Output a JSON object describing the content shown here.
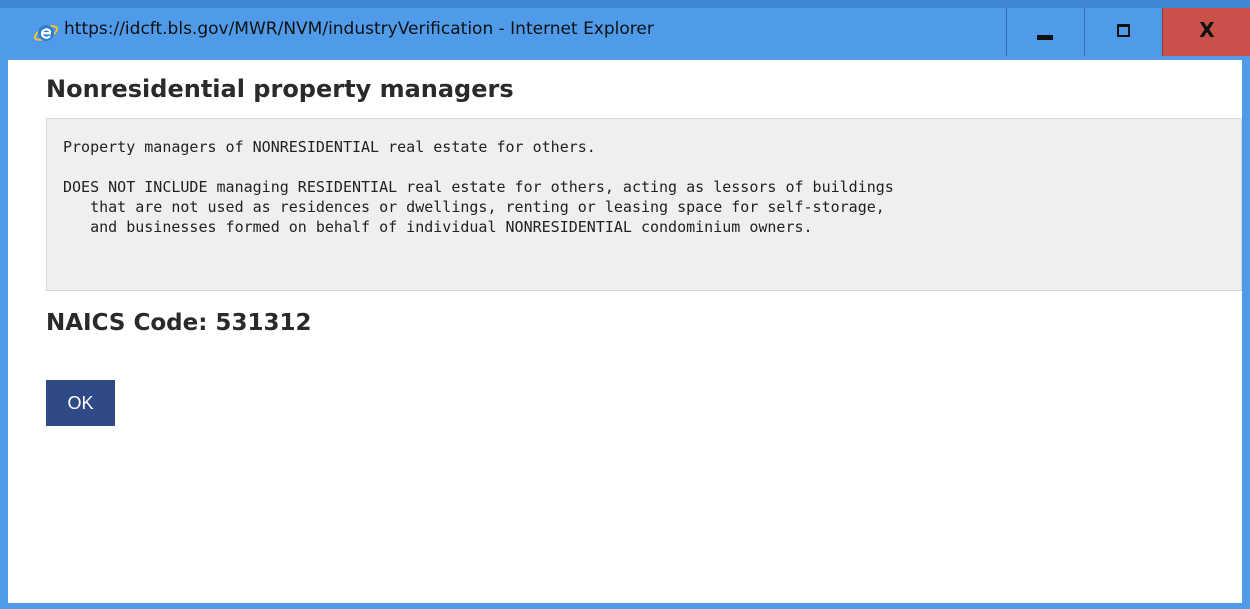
{
  "window": {
    "title": "https://idcft.bls.gov/MWR/NVM/industryVerification - Internet Explorer",
    "controls": {
      "minimize": "minimize-icon",
      "maximize": "maximize-icon",
      "close_label": "X"
    },
    "icon": "internet-explorer-icon",
    "colors": {
      "titlebar": "#4f9be9",
      "close": "#c9514a"
    }
  },
  "dialog": {
    "heading": "Nonresidential property managers",
    "description": {
      "line1": "Property managers of NONRESIDENTIAL real estate for others.",
      "line2": "DOES NOT INCLUDE managing RESIDENTIAL real estate for others, acting as lessors of buildings",
      "line3": "   that are not used as residences or dwellings, renting or leasing space for self-storage,",
      "line4": "   and businesses formed on behalf of individual NONRESIDENTIAL condominium owners."
    },
    "naics_code": "NAICS Code: 531312",
    "ok_label": "OK",
    "colors": {
      "button": "#2f4a87",
      "description_bg": "#efefef"
    }
  }
}
